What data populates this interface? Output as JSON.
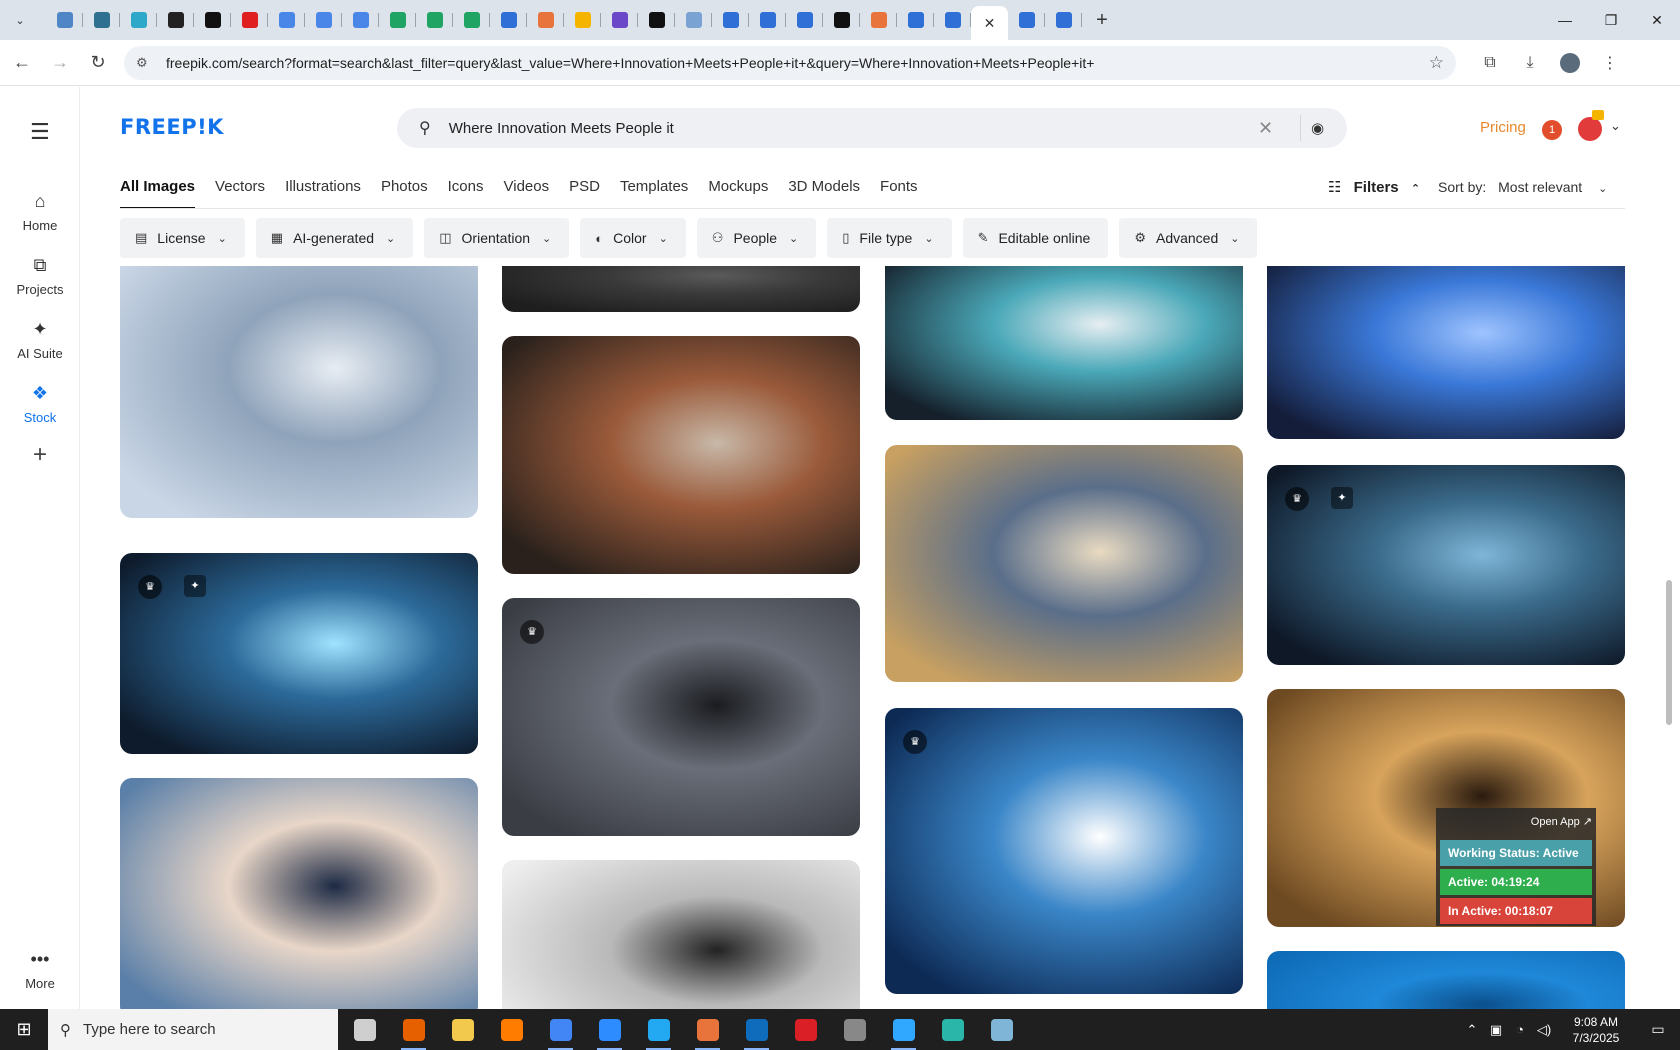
{
  "browser": {
    "tab_count": 27,
    "tab_colors": [
      "#4f86c6",
      "#2f6f8f",
      "#2ea8c8",
      "#222222",
      "#111111",
      "#e02020",
      "#4a86e8",
      "#4a86e8",
      "#4a86e8",
      "#1fa463",
      "#1fa463",
      "#1fa463",
      "#2f6fd6",
      "#e8743b",
      "#f4b400",
      "#6b48c8",
      "#111111",
      "#7aa3d4",
      "#2f6fd6",
      "#2f6fd6",
      "#2f6fd6",
      "#111111",
      "#e8743b",
      "#2f6fd6",
      "#2f6fd6",
      "#2f6fd6",
      "#2f6fd6"
    ],
    "new_tab_symbol": "+",
    "url": "freepik.com/search?format=search&last_filter=query&last_value=Where+Innovation+Meets+People+it+&query=Where+Innovation+Meets+People+it+"
  },
  "freepik": {
    "logo": "FREEP!K",
    "search_query": "Where Innovation Meets People it",
    "pricing": "Pricing",
    "notification_count": "1",
    "rail": [
      {
        "label": "Home",
        "icon": "home-icon"
      },
      {
        "label": "Projects",
        "icon": "projects-icon"
      },
      {
        "label": "AI Suite",
        "icon": "ai-suite-icon"
      },
      {
        "label": "Stock",
        "icon": "stock-icon"
      },
      {
        "label": "More",
        "icon": "more-icon"
      }
    ],
    "type_tabs": [
      "All Images",
      "Vectors",
      "Illustrations",
      "Photos",
      "Icons",
      "Videos",
      "PSD",
      "Templates",
      "Mockups",
      "3D Models",
      "Fonts"
    ],
    "filters_label": "Filters",
    "sort_label": "Sort by:",
    "sort_value": "Most relevant",
    "chips": [
      {
        "label": "License",
        "icon": "license-icon"
      },
      {
        "label": "AI-generated",
        "icon": "ai-generated-icon"
      },
      {
        "label": "Orientation",
        "icon": "orientation-icon"
      },
      {
        "label": "Color",
        "icon": "palette-icon"
      },
      {
        "label": "People",
        "icon": "people-icon"
      },
      {
        "label": "File type",
        "icon": "file-icon"
      },
      {
        "label": "Editable online",
        "icon": "pencil-icon"
      },
      {
        "label": "Advanced",
        "icon": "gear-icon"
      }
    ],
    "images": [
      {
        "name": "team-laptop-network",
        "colors": [
          "#c9d6e6",
          "#8fa3ba",
          "#e8edf3"
        ]
      },
      {
        "name": "team-glowing-sphere",
        "colors": [
          "#0e1b2c",
          "#2c6a9a",
          "#9fe3ff"
        ]
      },
      {
        "name": "team-blue-hologram",
        "colors": [
          "#5a7fa8",
          "#e8d6c8",
          "#1d2a44"
        ]
      },
      {
        "name": "dark-hands-partial",
        "colors": [
          "#1e1e1e",
          "#3a3a3a",
          "#5a5a5a"
        ]
      },
      {
        "name": "women-phone-red",
        "colors": [
          "#2a211c",
          "#9a5a3a",
          "#c8b8a8"
        ]
      },
      {
        "name": "meeting-overhead",
        "colors": [
          "#3a3d44",
          "#6a6e78",
          "#1a1c20"
        ]
      },
      {
        "name": "bw-team-laptop",
        "colors": [
          "#eeeeee",
          "#b9b9b9",
          "#222222"
        ]
      },
      {
        "name": "woman-tablet-glow",
        "colors": [
          "#15202b",
          "#4aa8b8",
          "#e7eef2"
        ]
      },
      {
        "name": "cafe-blur-couple",
        "colors": [
          "#c8a061",
          "#5a6e8a",
          "#eadbc2"
        ]
      },
      {
        "name": "men-idea-gears",
        "colors": [
          "#0d2a55",
          "#3a86c8",
          "#ffffff"
        ]
      },
      {
        "name": "isometric-circuit",
        "colors": [
          "#141d3a",
          "#3a78d8",
          "#9fc4ff"
        ]
      },
      {
        "name": "team-table-hologram",
        "colors": [
          "#0e1827",
          "#3a6a8a",
          "#7fb6d8"
        ]
      },
      {
        "name": "man-woman-glasses-warm",
        "colors": [
          "#6e4a22",
          "#d8a45c",
          "#2a1a0e"
        ]
      },
      {
        "name": "blue-tech-bottom",
        "colors": [
          "#0e6bb8",
          "#1f88d8",
          "#0b4f8c"
        ]
      }
    ]
  },
  "work_status": {
    "open_app": "Open App ↗",
    "status": "Working Status: Active",
    "active": "Active: 04:19:24",
    "inactive": "In Active: 00:18:07",
    "colors": {
      "status": "#4aa0a8",
      "active": "#2fae4e",
      "inactive": "#d9443a"
    }
  },
  "taskbar": {
    "search_placeholder": "Type here to search",
    "apps": [
      {
        "name": "task-view",
        "color": "#cfcfcf"
      },
      {
        "name": "firefox",
        "color": "#e66000"
      },
      {
        "name": "file-explorer",
        "color": "#f2c94c"
      },
      {
        "name": "illustrator",
        "color": "#ff7c00"
      },
      {
        "name": "chrome",
        "color": "#4285f4"
      },
      {
        "name": "zoom",
        "color": "#2d8cff"
      },
      {
        "name": "vscode",
        "color": "#23a9f2"
      },
      {
        "name": "draw-app",
        "color": "#e8743b"
      },
      {
        "name": "outlook",
        "color": "#0f6cbd"
      },
      {
        "name": "creative-cloud",
        "color": "#da1f26"
      },
      {
        "name": "pen-tool",
        "color": "#888888"
      },
      {
        "name": "photoshop",
        "color": "#31a8ff"
      },
      {
        "name": "app-teal",
        "color": "#2ab7a9"
      },
      {
        "name": "app-notepad",
        "color": "#7fb6d8"
      }
    ],
    "time": "9:08 AM",
    "date": "7/3/2025"
  }
}
